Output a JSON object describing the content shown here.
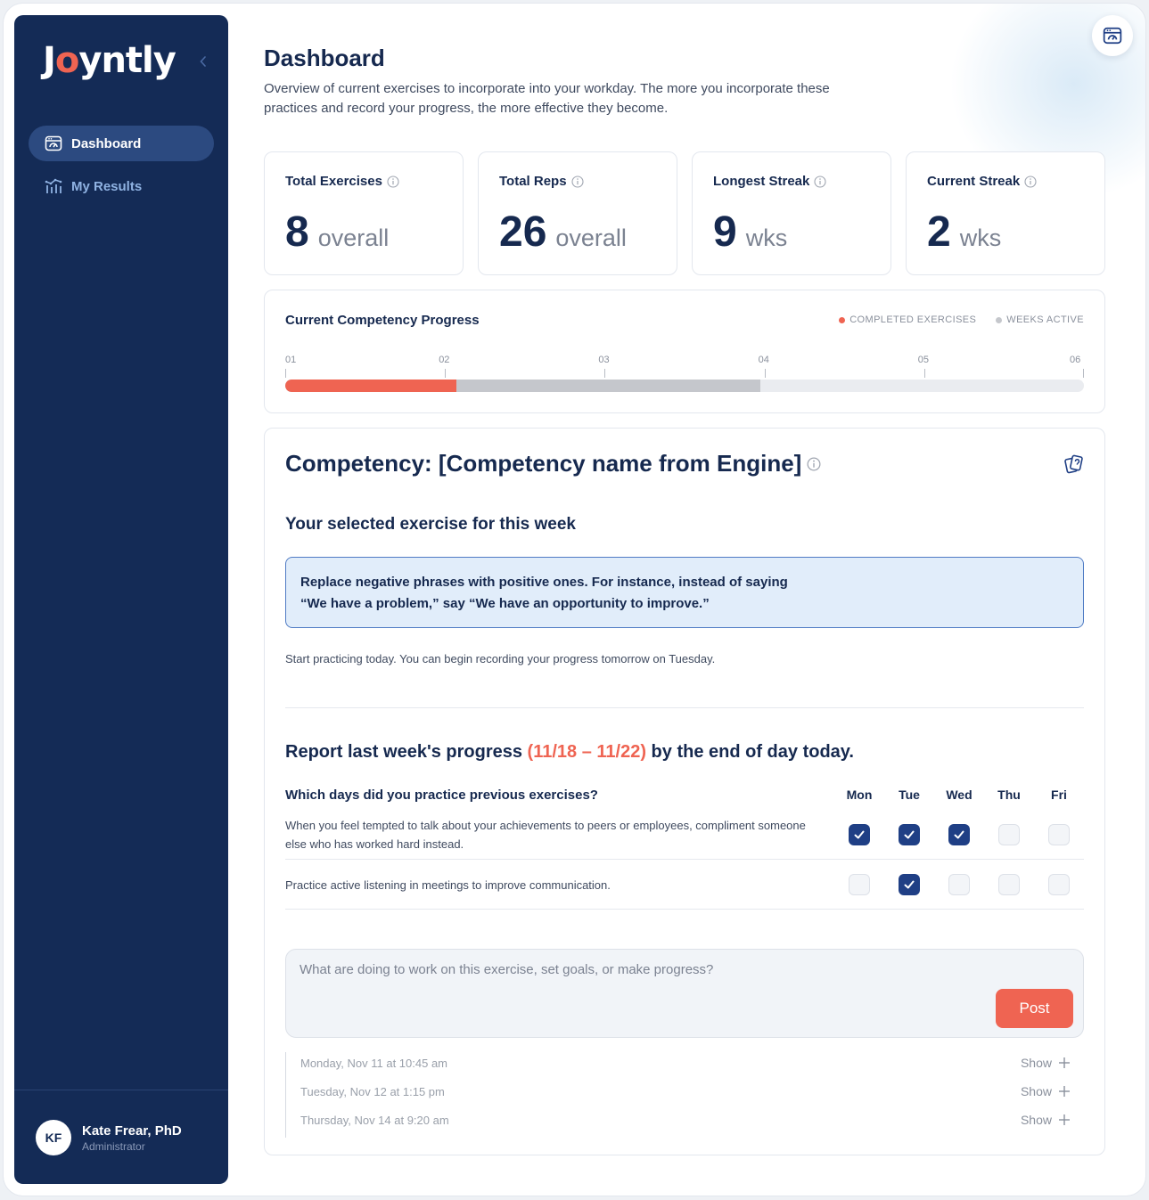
{
  "app": {
    "logo": {
      "prefix": "J",
      "accent": "o",
      "suffix": "yntly"
    },
    "brand_color": "#142b56",
    "accent_color": "#ef6452"
  },
  "sidebar": {
    "items": [
      {
        "label": "Dashboard",
        "icon": "dashboard-icon",
        "active": true
      },
      {
        "label": "My Results",
        "icon": "bar-chart-icon",
        "active": false
      }
    ],
    "user": {
      "initials": "KF",
      "name": "Kate Frear, PhD",
      "role": "Administrator"
    }
  },
  "header": {
    "title": "Dashboard",
    "subtitle": "Overview of current exercises to incorporate into your workday. The more you incorporate these practices and record your progress, the more effective they become."
  },
  "stats": [
    {
      "label": "Total Exercises",
      "value": "8",
      "unit": "overall"
    },
    {
      "label": "Total Reps",
      "value": "26",
      "unit": "overall"
    },
    {
      "label": "Longest Streak",
      "value": "9",
      "unit": "wks"
    },
    {
      "label": "Current Streak",
      "value": "2",
      "unit": "wks"
    }
  ],
  "progress": {
    "title": "Current Competency Progress",
    "legend": [
      {
        "label": "COMPLETED EXERCISES",
        "color": "#ef6452"
      },
      {
        "label": "WEEKS ACTIVE",
        "color": "#c5c7cc"
      }
    ],
    "ticks": [
      "01",
      "02",
      "03",
      "04",
      "05",
      "06"
    ],
    "completed_fraction": 0.214,
    "weeks_fraction": 0.595
  },
  "competency": {
    "title": "Competency: [Competency name from Engine]",
    "exercise_heading": "Your selected exercise for this week",
    "exercise_line1": "Replace negative phrases with positive ones. For instance, instead of saying",
    "exercise_line2": "“We have a problem,” say “We have an opportunity to improve.”",
    "start_note": "Start practicing today. You can begin recording your progress tomorrow on Tuesday.",
    "report_prefix": "Report last week's progress",
    "report_dates": "(11/18 – 11/22)",
    "report_suffix": "by the end of day today.",
    "question": "Which days did you practice previous exercises?",
    "days": [
      "Mon",
      "Tue",
      "Wed",
      "Thu",
      "Fri"
    ],
    "rows": [
      {
        "text": "When you feel tempted to talk about your achievements to peers or employees, compliment someone else who has worked hard instead.",
        "checked": [
          true,
          true,
          true,
          false,
          false
        ]
      },
      {
        "text": "Practice active listening in meetings to improve communication.",
        "checked": [
          false,
          true,
          false,
          false,
          false
        ]
      }
    ],
    "composer_placeholder": "What are doing to work on this exercise, set goals, or make progress?",
    "post_label": "Post",
    "history": [
      {
        "date": "Monday, Nov 11 at 10:45 am",
        "action": "Show"
      },
      {
        "date": "Tuesday, Nov 12 at 1:15 pm",
        "action": "Show"
      },
      {
        "date": "Thursday, Nov 14 at 9:20 am",
        "action": "Show"
      }
    ]
  }
}
